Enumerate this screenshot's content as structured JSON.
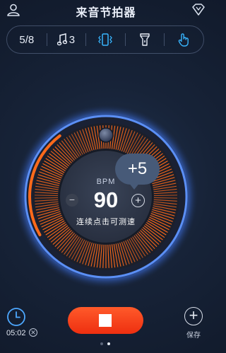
{
  "header": {
    "title": "来音节拍器",
    "profile_icon": "user-icon",
    "vip_icon": "vip-gem-icon"
  },
  "toolbar": {
    "time_signature": "5/8",
    "subdivision_value": "3",
    "subdivision_icon": "music-note-icon",
    "vibrate_icon": "vibrate-phone-icon",
    "flashlight_icon": "flashlight-icon",
    "tap_icon": "tap-hand-icon",
    "active_color": "#38b6ff"
  },
  "dial": {
    "bpm_label": "BPM",
    "bpm_value": "90",
    "tap_hint": "连续点击可测速",
    "minus_label": "−",
    "plus_label": "+",
    "bubble_text": "+5",
    "accent_color": "#ff6a1a",
    "ring_color": "#4c8dff",
    "progress_fraction": 0.23
  },
  "bottom": {
    "timer_value": "05:02",
    "timer_clear_label": "✕",
    "save_label": "保存",
    "save_symbol": "+",
    "stop_color": "#f23c15"
  },
  "pager": {
    "count": 2,
    "active_index": 1
  }
}
